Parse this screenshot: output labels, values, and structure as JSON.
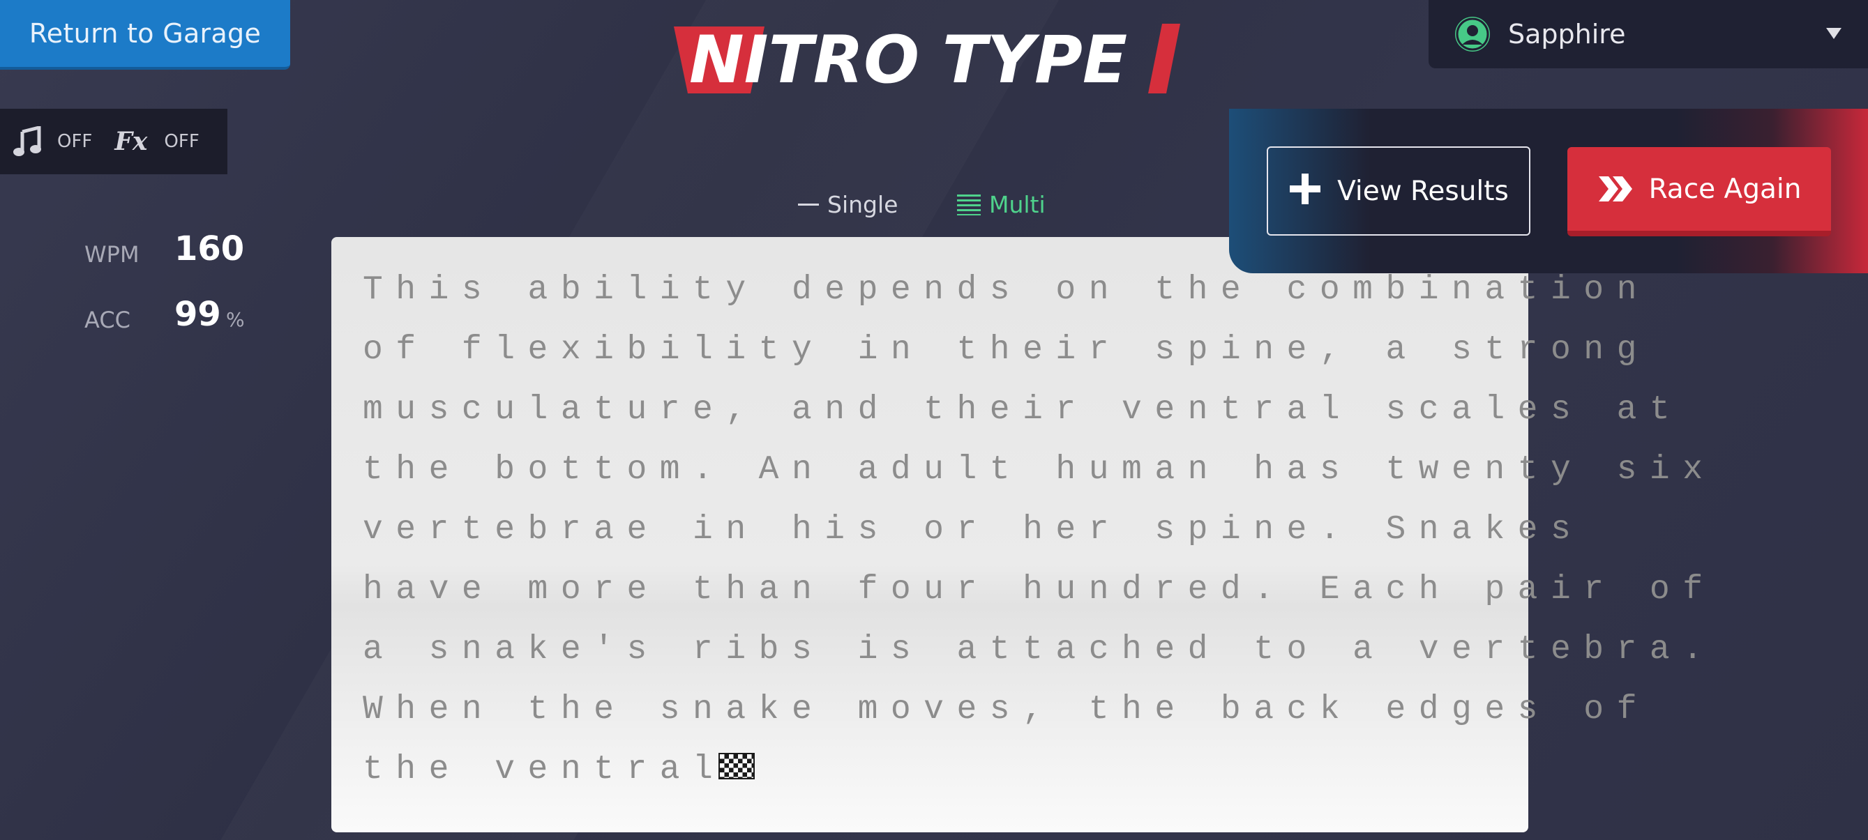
{
  "header": {
    "return_label": "Return to Garage",
    "logo_text": "NITRO TYPE"
  },
  "user": {
    "name": "Sapphire"
  },
  "sound": {
    "music_state": "OFF",
    "fx_icon": "Fx",
    "fx_state": "OFF"
  },
  "stats": {
    "wpm_label": "WPM",
    "wpm_value": "160",
    "acc_label": "ACC",
    "acc_value": "99",
    "acc_unit": "%"
  },
  "modes": {
    "single_label": "Single",
    "multi_label": "Multi",
    "selected": "Multi"
  },
  "passage": {
    "lines": [
      "This ability depends on the combination",
      "of flexibility in their spine, a strong",
      "musculature, and their ventral scales at",
      "the bottom. An adult human has twenty six",
      "vertebrae in his or her spine. Snakes",
      "have more than four hundred. Each pair of",
      "a snake's ribs is attached to a vertebra.",
      "When the snake moves, the back edges of",
      "the ventral"
    ]
  },
  "results": {
    "view_label": "View Results",
    "race_label": "Race Again"
  },
  "colors": {
    "accent_blue": "#1c7bc8",
    "accent_red": "#d62f3c",
    "multi_green": "#4fd38c",
    "background": "#2e3045"
  }
}
